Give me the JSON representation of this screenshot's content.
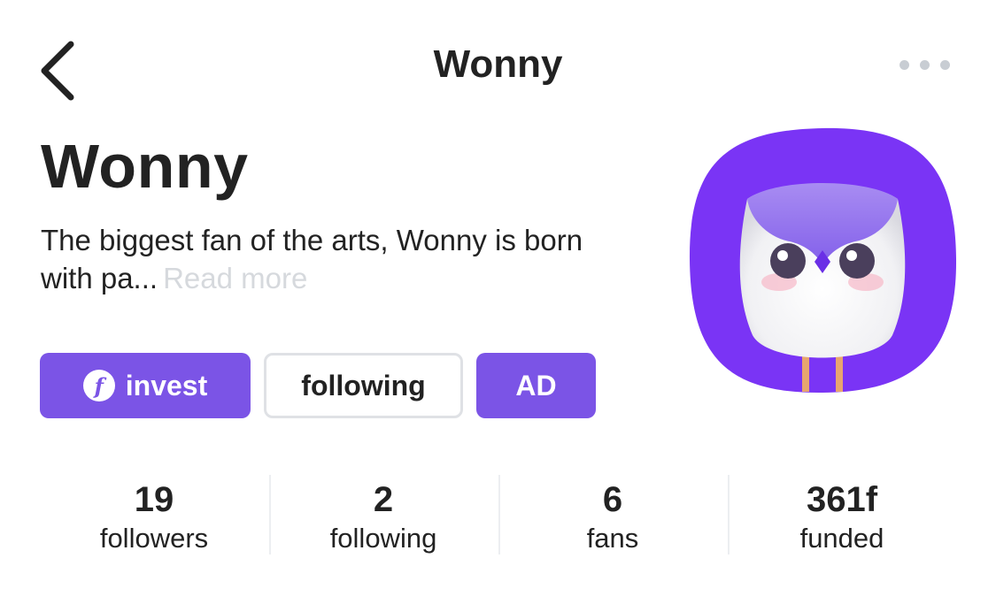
{
  "nav": {
    "title": "Wonny",
    "back_icon": "chevron-left-icon",
    "more_icon": "more-horizontal-icon"
  },
  "profile": {
    "name": "Wonny",
    "bio": "The biggest fan of the arts, Wonny is born with pa...",
    "read_more": "Read more",
    "avatar_icon": "owl-avatar"
  },
  "actions": {
    "invest_label": "invest",
    "invest_icon_glyph": "f",
    "following_label": "following",
    "ad_label": "AD"
  },
  "stats": [
    {
      "value": "19",
      "label": "followers"
    },
    {
      "value": "2",
      "label": "following"
    },
    {
      "value": "6",
      "label": "fans"
    },
    {
      "value": "361f",
      "label": "funded"
    }
  ],
  "colors": {
    "accent": "#7b54e6",
    "avatar_bg": "#7a34f5",
    "text": "#222222",
    "muted": "#d6d9dd"
  }
}
